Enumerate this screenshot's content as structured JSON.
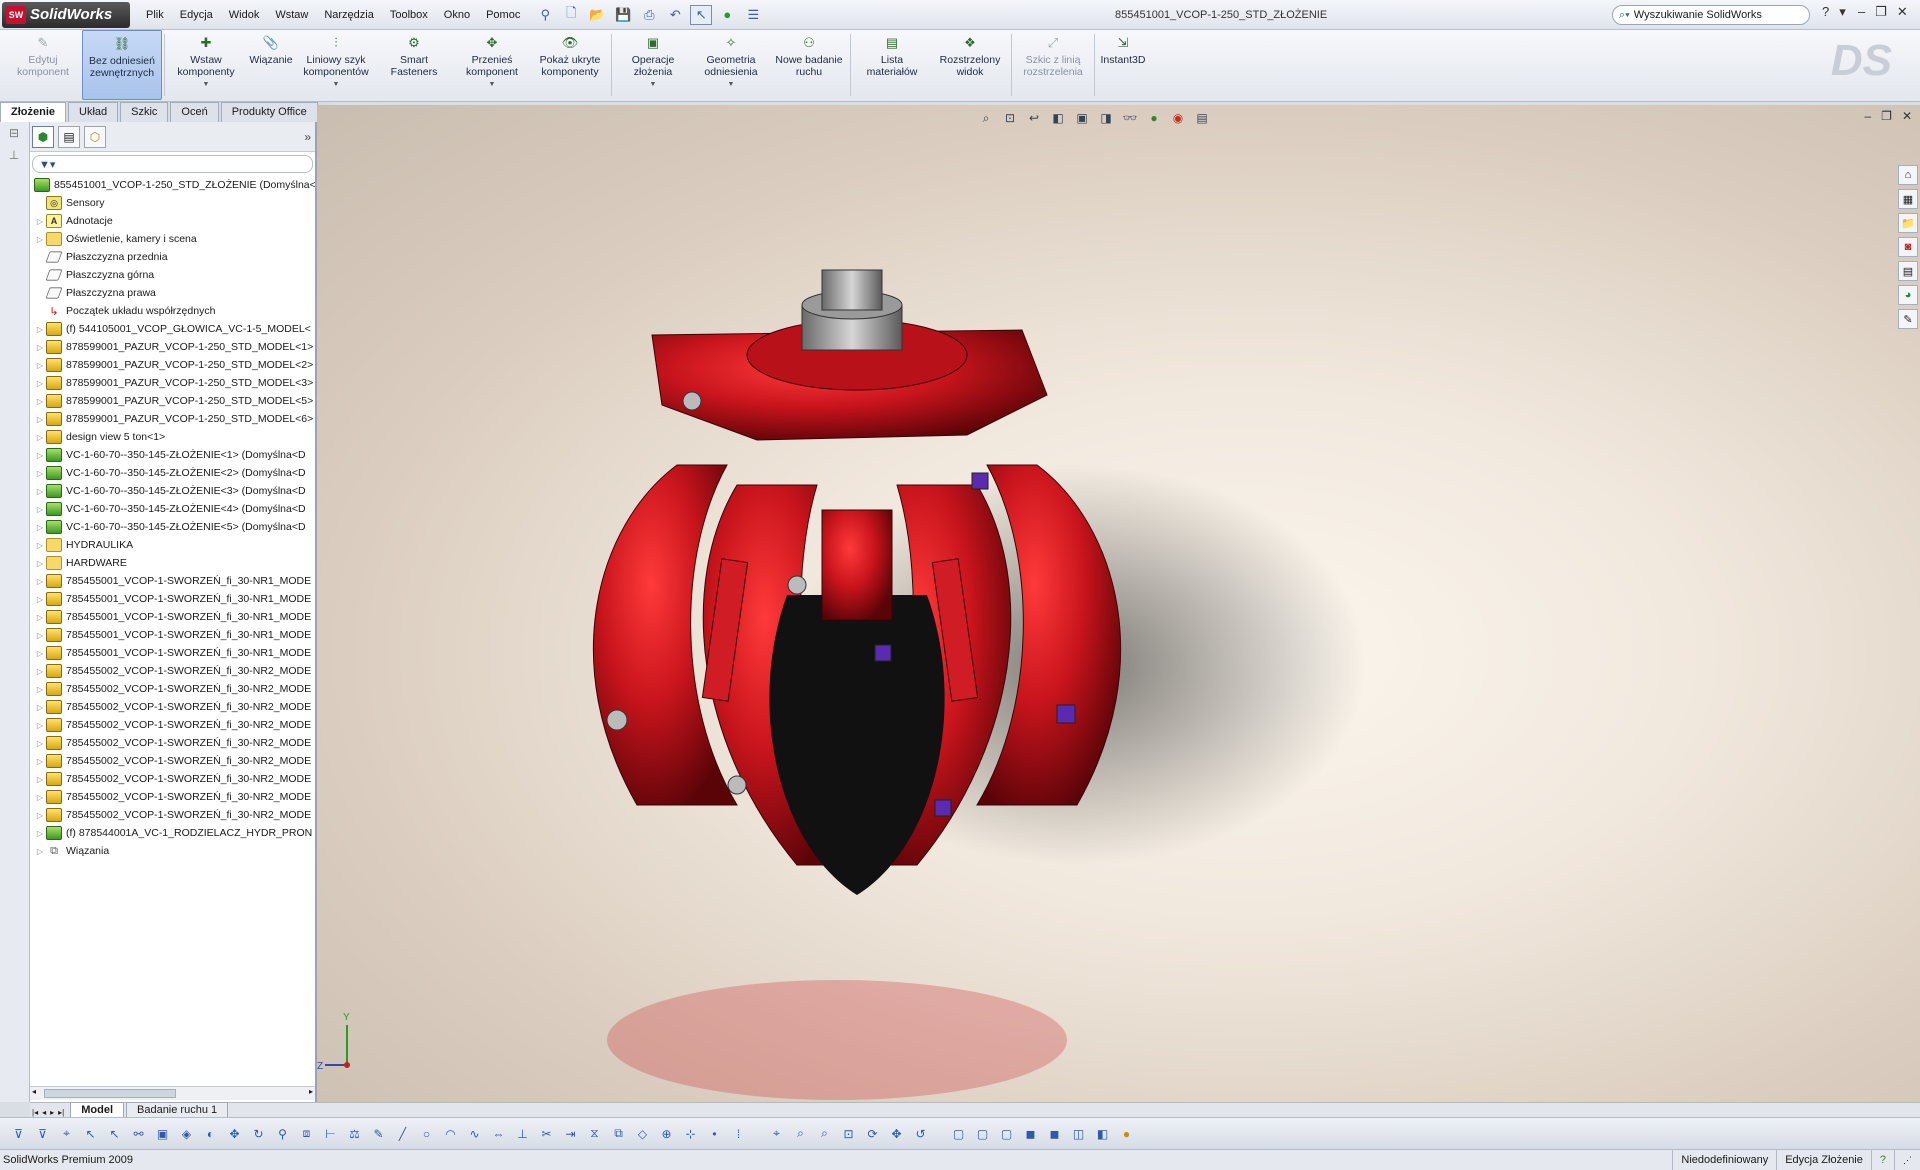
{
  "app": {
    "logo_badge": "SW",
    "logo_text": "SolidWorks",
    "document_title": "855451001_VCOP-1-250_STD_ZŁOŻENIE"
  },
  "menu": [
    "Plik",
    "Edycja",
    "Widok",
    "Wstaw",
    "Narzędzia",
    "Toolbox",
    "Okno",
    "Pomoc"
  ],
  "search": {
    "placeholder": "Wyszukiwanie SolidWorks"
  },
  "command_manager": [
    {
      "id": "edit",
      "label": "Edytuj komponent",
      "icon": "edit-component-icon",
      "glyph": "✎",
      "disabled": true
    },
    {
      "id": "noref",
      "label": "Bez odniesień zewnętrznych",
      "icon": "no-external-references-icon",
      "glyph": "⛓",
      "pressed": true
    },
    {
      "id": "insert",
      "label": "Wstaw komponenty",
      "icon": "insert-components-icon",
      "glyph": "✚",
      "arrow": true
    },
    {
      "id": "mate",
      "label": "Wiązanie",
      "icon": "mate-icon",
      "glyph": "📎"
    },
    {
      "id": "pattern",
      "label": "Liniowy szyk komponentów",
      "icon": "linear-pattern-icon",
      "glyph": "⫶",
      "arrow": true
    },
    {
      "id": "smart",
      "label": "Smart Fasteners",
      "icon": "smart-fasteners-icon",
      "glyph": "⚙"
    },
    {
      "id": "move",
      "label": "Przenieś komponent",
      "icon": "move-component-icon",
      "glyph": "✥",
      "arrow": true
    },
    {
      "id": "show",
      "label": "Pokaż ukryte komponenty",
      "icon": "show-hidden-icon",
      "glyph": "👁"
    },
    {
      "id": "features",
      "label": "Operacje złożenia",
      "icon": "assembly-features-icon",
      "glyph": "▣",
      "arrow": true
    },
    {
      "id": "geometry",
      "label": "Geometria odniesienia",
      "icon": "reference-geometry-icon",
      "glyph": "✧",
      "arrow": true
    },
    {
      "id": "motion",
      "label": "Nowe badanie ruchu",
      "icon": "new-motion-study-icon",
      "glyph": "⚇"
    },
    {
      "id": "bom",
      "label": "Lista materiałów",
      "icon": "bill-of-materials-icon",
      "glyph": "▤"
    },
    {
      "id": "exploded",
      "label": "Rozstrzelony widok",
      "icon": "exploded-view-icon",
      "glyph": "❖"
    },
    {
      "id": "explline",
      "label": "Szkic z linią rozstrzelenia",
      "icon": "explode-line-sketch-icon",
      "glyph": "⤢",
      "disabled": true
    },
    {
      "id": "instant3d",
      "label": "Instant3D",
      "icon": "instant3d-icon",
      "glyph": "⇲"
    }
  ],
  "tabs": [
    "Złożenie",
    "Układ",
    "Szkic",
    "Oceń",
    "Produkty Office"
  ],
  "tree": [
    {
      "label": "855451001_VCOP-1-250_STD_ZŁOŻENIE  (Domyślna<",
      "type": "asm",
      "root": true
    },
    {
      "label": "Sensory",
      "type": "sensor"
    },
    {
      "label": "Adnotacje",
      "type": "note",
      "glyph": "A",
      "exp": true
    },
    {
      "label": "Oświetlenie, kamery i scena",
      "type": "folder",
      "exp": true
    },
    {
      "label": "Płaszczyzna przednia",
      "type": "plane"
    },
    {
      "label": "Płaszczyzna górna",
      "type": "plane"
    },
    {
      "label": "Płaszczyzna prawa",
      "type": "plane"
    },
    {
      "label": "Początek układu współrzędnych",
      "type": "origin",
      "glyph": "↳"
    },
    {
      "label": "(f) 544105001_VCOP_GŁOWICA_VC-1-5_MODEL<",
      "type": "part",
      "exp": true
    },
    {
      "label": "878599001_PAZUR_VCOP-1-250_STD_MODEL<1>",
      "type": "part",
      "exp": true
    },
    {
      "label": "878599001_PAZUR_VCOP-1-250_STD_MODEL<2>",
      "type": "part",
      "exp": true
    },
    {
      "label": "878599001_PAZUR_VCOP-1-250_STD_MODEL<3>",
      "type": "part",
      "exp": true
    },
    {
      "label": "878599001_PAZUR_VCOP-1-250_STD_MODEL<5>",
      "type": "part",
      "exp": true
    },
    {
      "label": "878599001_PAZUR_VCOP-1-250_STD_MODEL<6>",
      "type": "part",
      "exp": true
    },
    {
      "label": "design view 5 ton<1>",
      "type": "part",
      "exp": true
    },
    {
      "label": "VC-1-60-70--350-145-ZŁOŻENIE<1> (Domyślna<D",
      "type": "asm",
      "exp": true
    },
    {
      "label": "VC-1-60-70--350-145-ZŁOŻENIE<2> (Domyślna<D",
      "type": "asm",
      "exp": true
    },
    {
      "label": "VC-1-60-70--350-145-ZŁOŻENIE<3> (Domyślna<D",
      "type": "asm",
      "exp": true
    },
    {
      "label": "VC-1-60-70--350-145-ZŁOŻENIE<4> (Domyślna<D",
      "type": "asm",
      "exp": true
    },
    {
      "label": "VC-1-60-70--350-145-ZŁOŻENIE<5> (Domyślna<D",
      "type": "asm",
      "exp": true
    },
    {
      "label": "HYDRAULIKA",
      "type": "folder",
      "exp": true
    },
    {
      "label": "HARDWARE",
      "type": "folder",
      "exp": true
    },
    {
      "label": "785455001_VCOP-1-SWORZEŃ_fi_30-NR1_MODE",
      "type": "part",
      "exp": true
    },
    {
      "label": "785455001_VCOP-1-SWORZEŃ_fi_30-NR1_MODE",
      "type": "part",
      "exp": true
    },
    {
      "label": "785455001_VCOP-1-SWORZEŃ_fi_30-NR1_MODE",
      "type": "part",
      "exp": true
    },
    {
      "label": "785455001_VCOP-1-SWORZEŃ_fi_30-NR1_MODE",
      "type": "part",
      "exp": true
    },
    {
      "label": "785455001_VCOP-1-SWORZEŃ_fi_30-NR1_MODE",
      "type": "part",
      "exp": true
    },
    {
      "label": "785455002_VCOP-1-SWORZEŃ_fi_30-NR2_MODE",
      "type": "part",
      "exp": true
    },
    {
      "label": "785455002_VCOP-1-SWORZEŃ_fi_30-NR2_MODE",
      "type": "part",
      "exp": true
    },
    {
      "label": "785455002_VCOP-1-SWORZEŃ_fi_30-NR2_MODE",
      "type": "part",
      "exp": true
    },
    {
      "label": "785455002_VCOP-1-SWORZEŃ_fi_30-NR2_MODE",
      "type": "part",
      "exp": true
    },
    {
      "label": "785455002_VCOP-1-SWORZEŃ_fi_30-NR2_MODE",
      "type": "part",
      "exp": true
    },
    {
      "label": "785455002_VCOP-1-SWORZEŃ_fi_30-NR2_MODE",
      "type": "part",
      "exp": true
    },
    {
      "label": "785455002_VCOP-1-SWORZEŃ_fi_30-NR2_MODE",
      "type": "part",
      "exp": true
    },
    {
      "label": "785455002_VCOP-1-SWORZEŃ_fi_30-NR2_MODE",
      "type": "part",
      "exp": true
    },
    {
      "label": "785455002_VCOP-1-SWORZEŃ_fi_30-NR2_MODE",
      "type": "part",
      "exp": true
    },
    {
      "label": "(f) 878544001A_VC-1_RODZIELACZ_HYDR_PRON",
      "type": "asm",
      "exp": true
    },
    {
      "label": "Wiązania",
      "type": "mates",
      "glyph": "⧉",
      "exp": true
    }
  ],
  "bottom_tabs": [
    "Model",
    "Badanie ruchu 1"
  ],
  "status": {
    "product": "SolidWorks Premium 2009",
    "definition": "Niedodefiniowany",
    "mode": "Edycja Złożenie"
  },
  "triad": {
    "y": "Y",
    "z": "Z"
  },
  "colors": {
    "model_red": "#c8141c",
    "accent_blue": "#3a5ea8"
  }
}
